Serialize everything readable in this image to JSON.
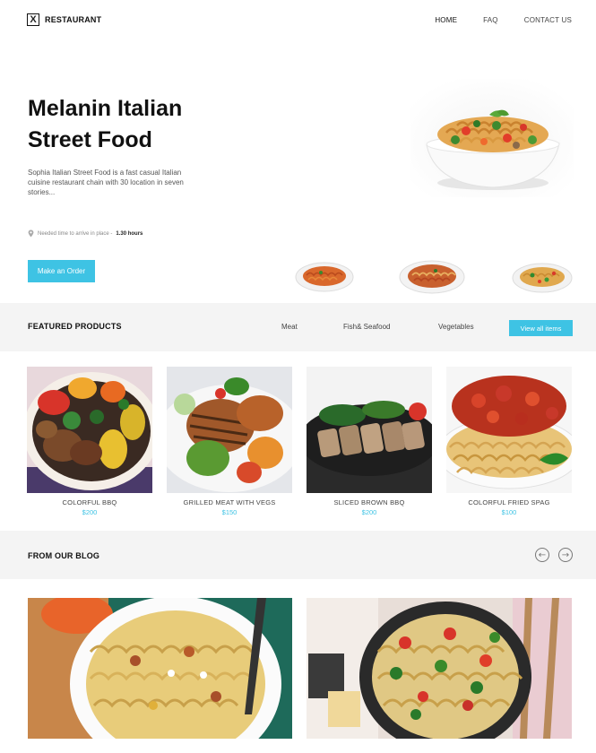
{
  "header": {
    "logo_mark": "X",
    "logo_text": "RESTAURANT",
    "nav": [
      {
        "label": "HOME"
      },
      {
        "label": "FAQ"
      },
      {
        "label": "CONTACT US"
      }
    ]
  },
  "hero": {
    "title_line1": "Melanin Italian",
    "title_line2": "Street Food",
    "description": "Sophia Italian Street Food is a fast casual Italian cuisine restaurant chain with 30 location in seven stories...",
    "arrive_label": "Needed time to arrive in place -",
    "arrive_value": "1.30 hours",
    "order_button": "Make an Order"
  },
  "featured": {
    "title": "FEATURED PRODUCTS",
    "filters": [
      "Meat",
      "Fish& Seafood",
      "Vegetables"
    ],
    "view_all": "View all items",
    "products": [
      {
        "name": "COLORFUL BBQ",
        "price": "$200"
      },
      {
        "name": "GRILLED MEAT WITH VEGS",
        "price": "$150"
      },
      {
        "name": "SLICED BROWN BBQ",
        "price": "$200"
      },
      {
        "name": "COLORFUL FRIED SPAG",
        "price": "$100"
      }
    ]
  },
  "blog": {
    "title": "FROM OUR BLOG",
    "prev_icon": "arrow-left-icon",
    "next_icon": "arrow-right-icon"
  },
  "colors": {
    "accent": "#3ec3e4",
    "band": "#f4f4f4"
  }
}
